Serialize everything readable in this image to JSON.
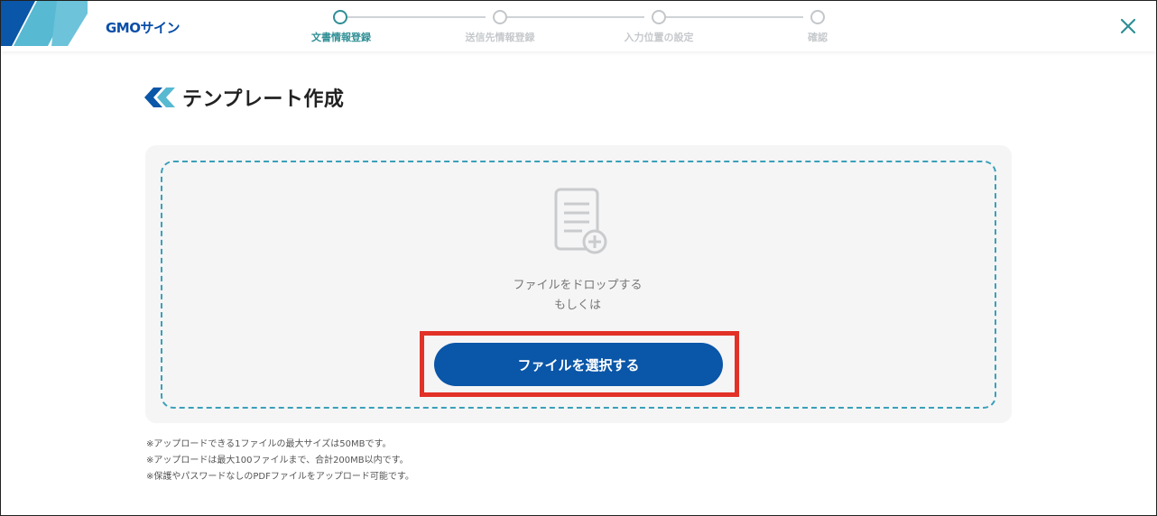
{
  "header": {
    "brand": "GMOサイン",
    "close_label": "×"
  },
  "stepper": {
    "steps": [
      {
        "label": "文書情報登録",
        "active": true
      },
      {
        "label": "送信先情報登録",
        "active": false
      },
      {
        "label": "入力位置の設定",
        "active": false
      },
      {
        "label": "確認",
        "active": false
      }
    ]
  },
  "page": {
    "title": "テンプレート作成"
  },
  "upload": {
    "drop_text_line1": "ファイルをドロップする",
    "drop_text_line2": "もしくは",
    "select_button_label": "ファイルを選択する"
  },
  "notes": [
    "※アップロードできる1ファイルの最大サイズは50MBです。",
    "※アップロードは最大100ファイルまで、合計200MB以内です。",
    "※保護やパスワードなしのPDFファイルをアップロード可能です。"
  ],
  "colors": {
    "accent": "#2f8f95",
    "primary_button": "#0a56a8",
    "highlight_border": "#e23127",
    "dashed_border": "#3aa0b8"
  },
  "icons": [
    "gmo-corner-logo",
    "close-icon",
    "title-logo-icon",
    "document-add-icon"
  ]
}
